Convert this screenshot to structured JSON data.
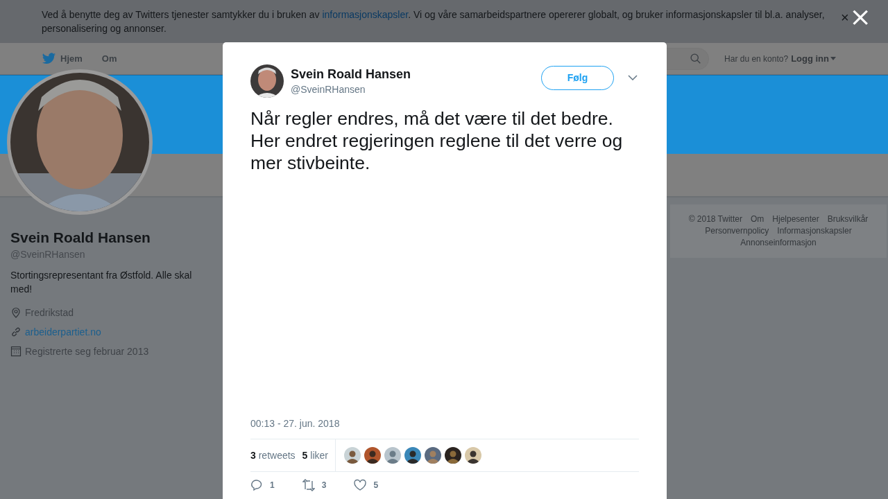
{
  "cookie_banner": {
    "text_before": "Ved å benytte deg av Twitters tjenester samtykker du i bruken av ",
    "link": "informasjonskapsler",
    "text_after": ". Vi og våre samarbeidspartnere opererer globalt, og bruker informasjonskapsler til bl.a. analyser, personalisering og annonser.",
    "close": "×"
  },
  "nav": {
    "items": [
      {
        "label": "Hjem",
        "selected": true
      },
      {
        "label": "Om",
        "selected": false
      }
    ],
    "account_prompt": "Har du en konto?",
    "login": "Logg inn"
  },
  "profile": {
    "name": "Svein Roald Hansen",
    "handle": "@SveinRHansen",
    "bio": "Stortingsrepresentant fra Østfold. Alle skal med!",
    "location": "Fredrikstad",
    "website": "arbeiderpartiet.no",
    "joined": "Registrerte seg februar 2013"
  },
  "footer_links": [
    "© 2018 Twitter",
    "Om",
    "Hjelpesenter",
    "Bruksvilkår",
    "Personvernpolicy",
    "Informasjonskapsler",
    "Annonseinformasjon"
  ],
  "modal": {
    "close": "×",
    "author": {
      "name": "Svein Roald Hansen",
      "handle": "@SveinRHansen"
    },
    "follow": "Følg",
    "text": "Når regler endres, må det være til det bedre. Her endret regjeringen reglene til det verre og mer stivbeinte.",
    "timestamp": "00:13 - 27. jun. 2018",
    "stats": [
      {
        "count": "3",
        "label": "retweets"
      },
      {
        "count": "5",
        "label": "liker"
      }
    ],
    "actions": [
      {
        "kind": "reply",
        "count": "1"
      },
      {
        "kind": "retweet",
        "count": "3"
      },
      {
        "kind": "like",
        "count": "5"
      }
    ]
  }
}
